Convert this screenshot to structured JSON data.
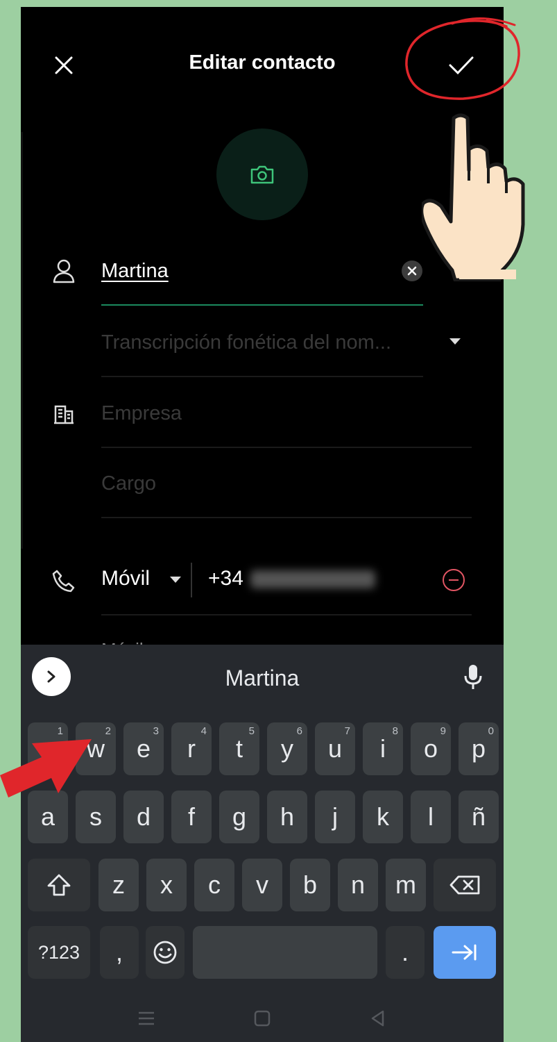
{
  "header": {
    "title": "Editar contacto",
    "close_icon": "close-icon",
    "confirm_icon": "check-icon"
  },
  "avatar": {
    "icon": "camera-icon"
  },
  "fields": {
    "name": {
      "value": "Martina",
      "icon": "person-icon"
    },
    "phonetic": {
      "placeholder": "Transcripción fonética del nom..."
    },
    "company": {
      "placeholder": "Empresa",
      "icon": "building-icon"
    },
    "title": {
      "placeholder": "Cargo"
    }
  },
  "phone": {
    "type": "Móvil",
    "prefix": "+34",
    "icon": "phone-icon",
    "next_type_partial": "Móvil"
  },
  "keyboard": {
    "suggestion": "Martina",
    "row1": [
      {
        "k": "q",
        "n": "1"
      },
      {
        "k": "w",
        "n": "2"
      },
      {
        "k": "e",
        "n": "3"
      },
      {
        "k": "r",
        "n": "4"
      },
      {
        "k": "t",
        "n": "5"
      },
      {
        "k": "y",
        "n": "6"
      },
      {
        "k": "u",
        "n": "7"
      },
      {
        "k": "i",
        "n": "8"
      },
      {
        "k": "o",
        "n": "9"
      },
      {
        "k": "p",
        "n": "0"
      }
    ],
    "row2": [
      "a",
      "s",
      "d",
      "f",
      "g",
      "h",
      "j",
      "k",
      "l",
      "ñ"
    ],
    "row3": [
      "z",
      "x",
      "c",
      "v",
      "b",
      "n",
      "m"
    ],
    "sym": "?123",
    "comma": ",",
    "period": "."
  },
  "colors": {
    "accent": "#5b9bf0",
    "danger": "#e25563",
    "background": "#9dcfa1"
  }
}
